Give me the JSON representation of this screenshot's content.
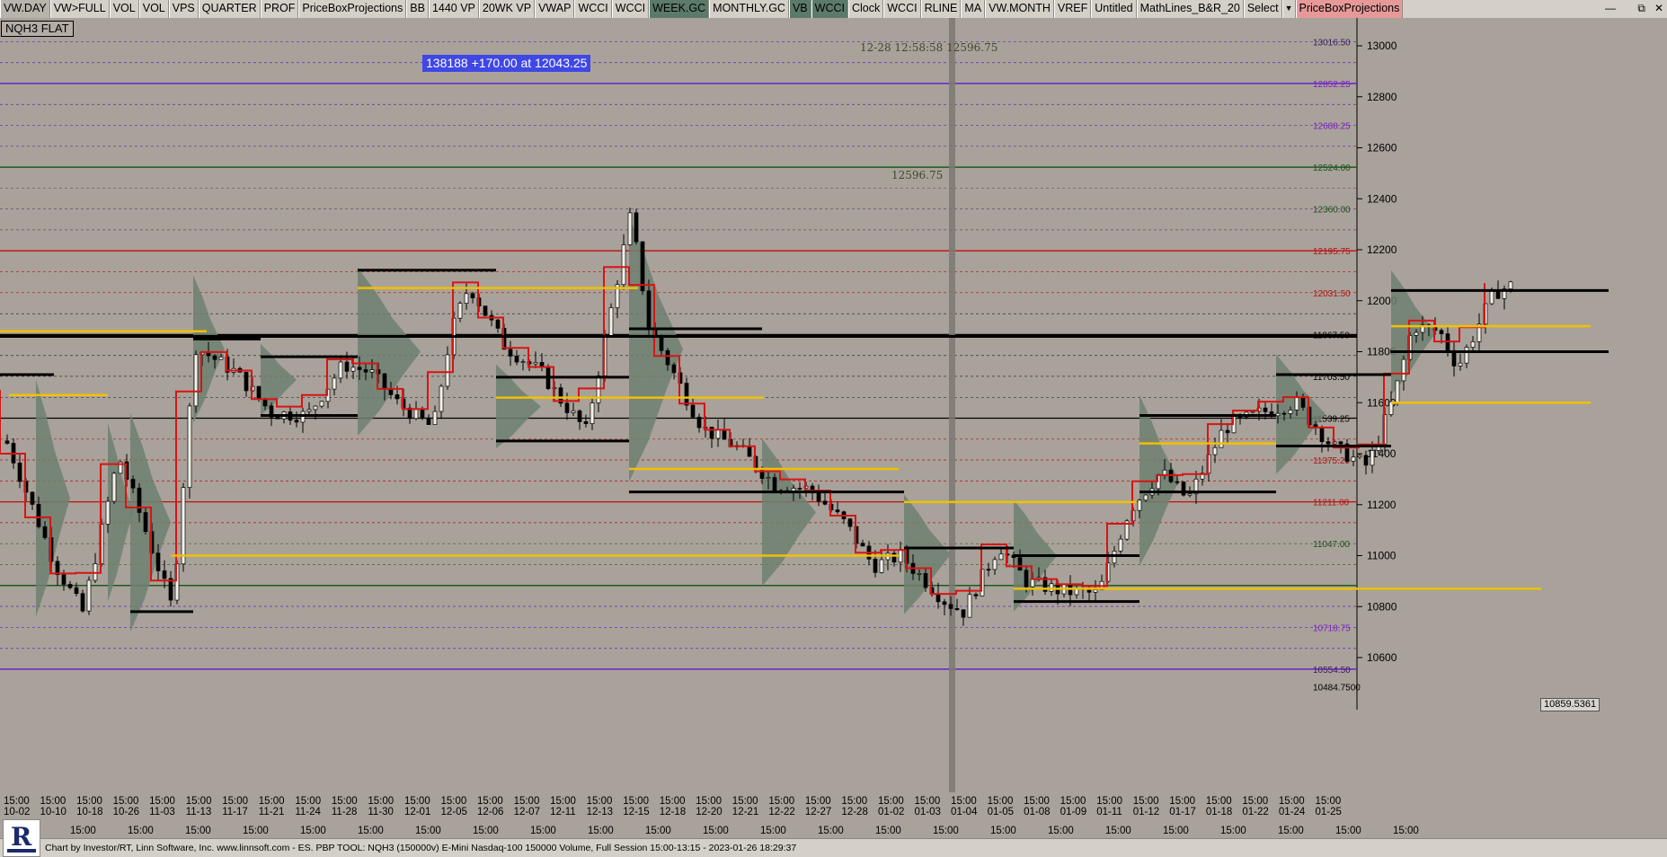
{
  "toolbar": {
    "buttons": [
      {
        "label": "VW.DAY",
        "style": "sel"
      },
      {
        "label": "VW>FULL",
        "style": ""
      },
      {
        "label": "VOL",
        "style": ""
      },
      {
        "label": "VOL",
        "style": ""
      },
      {
        "label": "VPS",
        "style": ""
      },
      {
        "label": "QUARTER",
        "style": ""
      },
      {
        "label": "PROF",
        "style": ""
      },
      {
        "label": "PriceBoxProjections",
        "style": ""
      },
      {
        "label": "BB",
        "style": ""
      },
      {
        "label": "1440 VP",
        "style": ""
      },
      {
        "label": "20WK VP",
        "style": ""
      },
      {
        "label": "VWAP",
        "style": ""
      },
      {
        "label": "WCCI",
        "style": ""
      },
      {
        "label": "WCCI",
        "style": ""
      },
      {
        "label": "WEEK.GC",
        "style": "dark"
      },
      {
        "label": "MONTHLY.GC",
        "style": ""
      },
      {
        "label": "VB",
        "style": "dark"
      },
      {
        "label": "WCCI",
        "style": "dark"
      },
      {
        "label": "Clock",
        "style": ""
      },
      {
        "label": "WCCI",
        "style": ""
      },
      {
        "label": "RLINE",
        "style": ""
      },
      {
        "label": "MA",
        "style": ""
      },
      {
        "label": "VW.MONTH",
        "style": ""
      },
      {
        "label": "VREF",
        "style": ""
      },
      {
        "label": "Untitled",
        "style": ""
      },
      {
        "label": "MathLines_B&R_20",
        "style": ""
      },
      {
        "label": "Select",
        "style": ""
      },
      {
        "label": "▼",
        "style": "arrow"
      },
      {
        "label": "PriceBoxProjections",
        "style": "pink"
      }
    ],
    "window_icons": [
      "⧉",
      "✕"
    ],
    "minimize_icon": "—"
  },
  "chart": {
    "symbol_label": "NQH3 FLAT",
    "trade_label": "138188  +170.00 at 12043.25",
    "cursor_readout": "12-28  12:58:58  12596.75",
    "cursor_price_label": "12596.75",
    "price_marker": "10859.5361",
    "price_axis": {
      "ticks": [
        "13000",
        "12800",
        "12600",
        "12400",
        "12200",
        "12000",
        "11800",
        "11600",
        "11400",
        "11200",
        "11000",
        "10800",
        "10600"
      ]
    },
    "level_labels": [
      {
        "text": "13016.50",
        "color": "#3a1a5a"
      },
      {
        "text": "12852.25",
        "color": "#7b1fbf"
      },
      {
        "text": "12688.25",
        "color": "#7b1fbf"
      },
      {
        "text": "12524.00",
        "color": "#1e4d1e"
      },
      {
        "text": "12360.00",
        "color": "#1e4d1e"
      },
      {
        "text": "12195.75",
        "color": "#b01010"
      },
      {
        "text": "12031.50",
        "color": "#b01010"
      },
      {
        "text": "11867.50",
        "color": "#000000"
      },
      {
        "text": "11703.50",
        "color": "#000000"
      },
      {
        "text": "11539.25",
        "color": "#000000"
      },
      {
        "text": "11375.25",
        "color": "#b01010"
      },
      {
        "text": "11211.00",
        "color": "#b01010"
      },
      {
        "text": "11047.00",
        "color": "#1e4d1e"
      },
      {
        "text": "10718.75",
        "color": "#7b1fbf"
      },
      {
        "text": "10554.50",
        "color": "#3a1a5a"
      },
      {
        "text": "10484.7500",
        "color": "#000000"
      }
    ],
    "time_axis_top": [
      "15:00",
      "15:00",
      "15:00",
      "15:00",
      "15:00",
      "15:00",
      "15:00",
      "15:00",
      "15:00",
      "15:00",
      "15:00",
      "15:00",
      "15:00",
      "15:00",
      "15:00",
      "15:00",
      "15:00",
      "15:00",
      "15:00",
      "15:00",
      "15:00",
      "15:00",
      "15:00",
      "15:00",
      "15:00",
      "15:00",
      "15:00",
      "15:00",
      "15:00",
      "15:00",
      "15:00",
      "15:00",
      "15:00",
      "15:00",
      "15:00",
      "15:00",
      "15:00",
      "15:00",
      "15:00",
      "15:00"
    ],
    "date_labels": [
      "10-02",
      "10-10",
      "10-18",
      "10-26",
      "11-03",
      "11-13",
      "11-17",
      "11-21",
      "11-24",
      "11-28",
      "11-30",
      "12-01",
      "12-05",
      "12-06",
      "12-07",
      "12-11",
      "12-13",
      "12-15",
      "12-18",
      "12-20",
      "12-21",
      "12-22",
      "12-27",
      "12-28",
      "01-02",
      "01-03",
      "01-04",
      "01-05",
      "01-08",
      "01-09",
      "01-11",
      "01-12",
      "01-17",
      "01-18",
      "01-22",
      "01-24",
      "01-25"
    ],
    "time_axis_bottom": [
      "15:00",
      "15:00",
      "15:00",
      "15:00",
      "15:00",
      "15:00",
      "15:00",
      "15:00",
      "15:00",
      "15:00",
      "15:00",
      "15:00",
      "15:00",
      "15:00",
      "15:00",
      "15:00",
      "15:00",
      "15:00",
      "15:00",
      "15:00",
      "15:00",
      "15:00",
      "15:00",
      "15:00"
    ]
  },
  "status": {
    "text": "Chart by Investor/RT, Linn Software, Inc. www.linnsoft.com - ES. PBP TOOL: NQH3 (150000v) E-Mini Nasdaq-100 150000 Volume, Full Session 15:00-13:15 - 2023-01-26 18:29:37"
  }
}
